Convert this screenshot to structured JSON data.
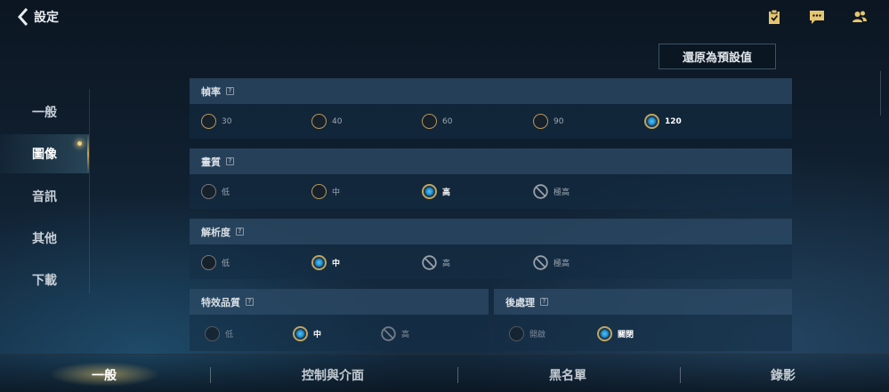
{
  "header": {
    "back_label": "設定",
    "icons": [
      "clipboard-check-icon",
      "chat-icon",
      "friends-icon"
    ]
  },
  "reset_button": "還原為預設值",
  "sidebar": {
    "items": [
      {
        "label": "一般",
        "active": false
      },
      {
        "label": "圖像",
        "active": true
      },
      {
        "label": "音訊",
        "active": false
      },
      {
        "label": "其他",
        "active": false
      },
      {
        "label": "下載",
        "active": false
      }
    ]
  },
  "sections": {
    "framerate": {
      "title": "幀率",
      "help": "?",
      "options": [
        "30",
        "40",
        "60",
        "90",
        "120"
      ],
      "selected": "120"
    },
    "quality": {
      "title": "畫質",
      "help": "?",
      "options": [
        "低",
        "中",
        "高",
        "極高"
      ],
      "selected": "高",
      "disabled": [
        "極高"
      ]
    },
    "resolution": {
      "title": "解析度",
      "help": "?",
      "options": [
        "低",
        "中",
        "高",
        "極高"
      ],
      "selected": "中",
      "disabled": [
        "高",
        "極高"
      ]
    },
    "effects": {
      "title": "特效品質",
      "help": "?",
      "options": [
        "低",
        "中",
        "高"
      ],
      "selected": "中",
      "disabled": [
        "高"
      ]
    },
    "postprocess": {
      "title": "後處理",
      "help": "?",
      "options": [
        "開啟",
        "關閉"
      ],
      "selected": "關閉"
    }
  },
  "bottom_tabs": [
    {
      "label": "一般",
      "active": true
    },
    {
      "label": "控制與介面",
      "active": false
    },
    {
      "label": "黑名單",
      "active": false
    },
    {
      "label": "錄影",
      "active": false
    }
  ],
  "colors": {
    "accent_gold": "#c9a45a",
    "selected_blue": "#4fc3ff"
  }
}
